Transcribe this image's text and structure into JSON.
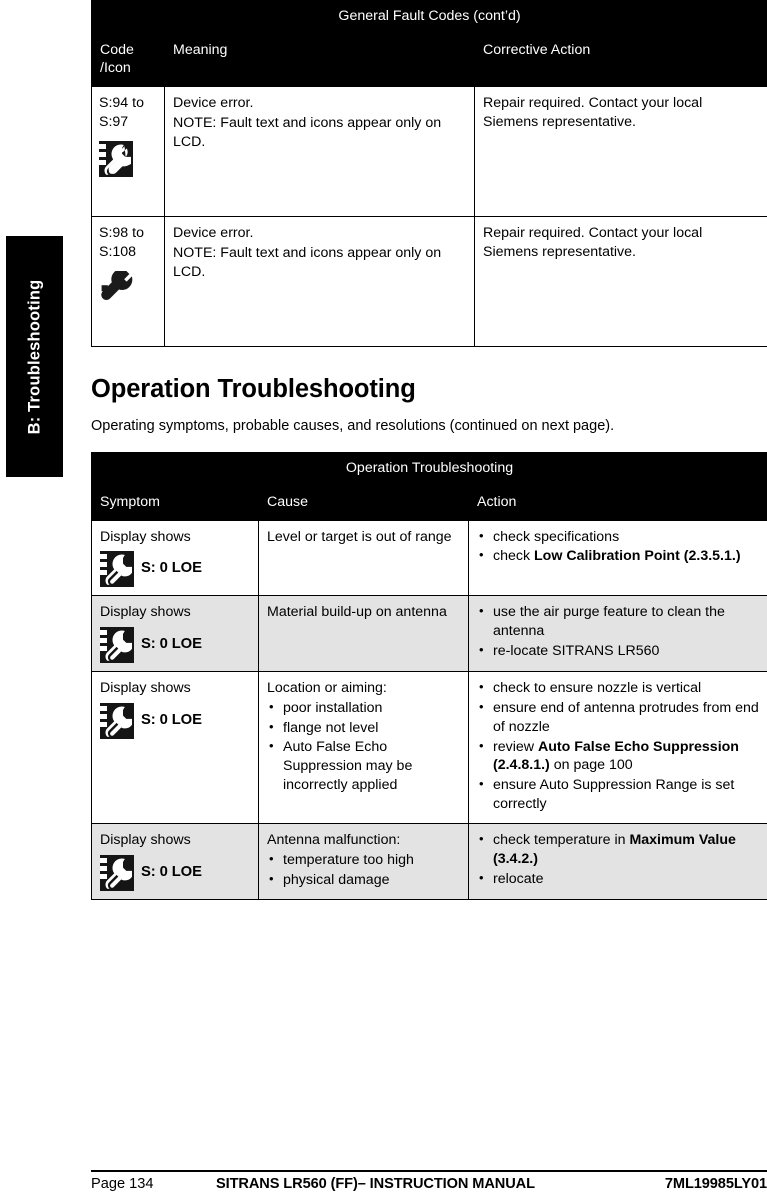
{
  "sidebar": {
    "tab_label": "B: Troubleshooting"
  },
  "fault_table": {
    "title": "General Fault Codes (cont’d)",
    "headers": {
      "code": "Code\n/Icon",
      "code_line1": "Code",
      "code_line2": "/Icon",
      "meaning": "Meaning",
      "action": "Corrective Action"
    },
    "rows": [
      {
        "code_line1": "S:94 to",
        "code_line2": "S:97",
        "icon": "wrench-boxed-icon",
        "meaning_line1": "Device error.",
        "meaning_line2": "NOTE: Fault text and icons appear only on LCD.",
        "action": "Repair required. Contact your local Siemens representative."
      },
      {
        "code_line1": "S:98 to",
        "code_line2": "S:108",
        "icon": "wrench-plain-icon",
        "meaning_line1": "Device error.",
        "meaning_line2": "NOTE: Fault text and icons appear only on LCD.",
        "action": "Repair required. Contact your local Siemens representative."
      }
    ]
  },
  "section": {
    "title": "Operation Troubleshooting",
    "intro": "Operating symptoms, probable causes, and resolutions (continued on next page)."
  },
  "operation_table": {
    "title": "Operation Troubleshooting",
    "headers": {
      "symptom": "Symptom",
      "cause": "Cause",
      "action": "Action"
    },
    "rows": [
      {
        "shaded": false,
        "symptom_label": "Display shows",
        "symptom_icon": "wrench-boxed-icon",
        "symptom_code": "S: 0 LOE",
        "cause_lead": "Level or target is out of range",
        "cause_bullets": [],
        "action_bullets": [
          {
            "text": "check specifications",
            "bold": "",
            "tail": ""
          },
          {
            "text": "check ",
            "bold": "Low Calibration Point (2.3.5.1.)",
            "tail": ""
          }
        ]
      },
      {
        "shaded": true,
        "symptom_label": "Display shows",
        "symptom_icon": "wrench-boxed-icon",
        "symptom_code": "S: 0 LOE",
        "cause_lead": "Material build-up on antenna",
        "cause_bullets": [],
        "action_bullets": [
          {
            "text": "use the air purge feature to clean the antenna",
            "bold": "",
            "tail": ""
          },
          {
            "text": "re-locate SITRANS LR560",
            "bold": "",
            "tail": ""
          }
        ]
      },
      {
        "shaded": false,
        "symptom_label": "Display shows",
        "symptom_icon": "wrench-boxed-icon",
        "symptom_code": "S: 0 LOE",
        "cause_lead": "Location or aiming:",
        "cause_bullets": [
          "poor installation",
          "flange not level",
          "Auto False Echo Suppression may be incorrectly applied"
        ],
        "action_bullets": [
          {
            "text": "check to ensure nozzle is vertical",
            "bold": "",
            "tail": ""
          },
          {
            "text": "ensure end of antenna protrudes from end of nozzle",
            "bold": "",
            "tail": ""
          },
          {
            "text": "review ",
            "bold": "Auto False Echo Suppression (2.4.8.1.)",
            "tail": " on page 100"
          },
          {
            "text": "ensure Auto Suppression Range is set correctly",
            "bold": "",
            "tail": ""
          }
        ]
      },
      {
        "shaded": true,
        "symptom_label": "Display shows",
        "symptom_icon": "wrench-boxed-icon",
        "symptom_code": "S: 0 LOE",
        "cause_lead": "Antenna malfunction:",
        "cause_bullets": [
          "temperature too high",
          "physical damage"
        ],
        "action_bullets": [
          {
            "text": "check temperature in ",
            "bold": "Maximum Value (3.4.2.)",
            "tail": ""
          },
          {
            "text": "relocate",
            "bold": "",
            "tail": ""
          }
        ]
      }
    ]
  },
  "footer": {
    "page": "Page 134",
    "manual": "SITRANS LR560 (FF)– INSTRUCTION MANUAL",
    "doc_number": "7ML19985LY01"
  },
  "colors": {
    "header_bg": "#000000",
    "header_fg": "#ffffff",
    "shaded_row": "#e3e3e3",
    "border": "#000000"
  }
}
